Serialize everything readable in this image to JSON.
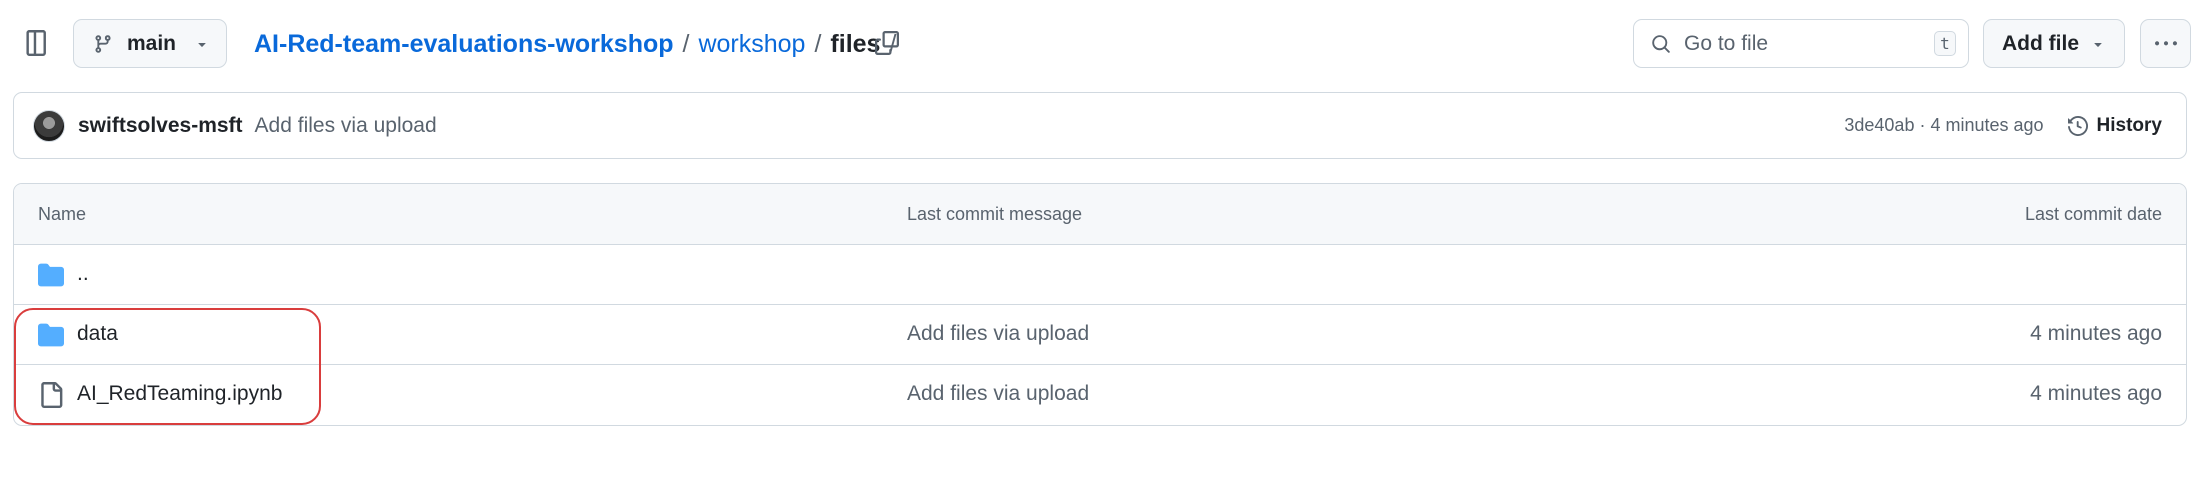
{
  "topbar": {
    "branch": "main",
    "breadcrumb": {
      "repo": "AI-Red-team-evaluations-workshop",
      "sep1": "/",
      "dir": "workshop",
      "sep2": "/",
      "current": "files",
      "sep3": "/"
    },
    "search_placeholder": "Go to file",
    "search_shortcut": "t",
    "add_file_label": "Add file"
  },
  "commit": {
    "author": "swiftsolves-msft",
    "message": "Add files via upload",
    "hash_time": "3de40ab · 4 minutes ago",
    "history_label": "History"
  },
  "table": {
    "headers": {
      "name": "Name",
      "message": "Last commit message",
      "date": "Last commit date"
    },
    "rows": [
      {
        "icon": "folder-icon",
        "name": "..",
        "message": "",
        "date": ""
      },
      {
        "icon": "folder-icon",
        "name": "data",
        "message": "Add files via upload",
        "date": "4 minutes ago"
      },
      {
        "icon": "file-icon",
        "name": "AI_RedTeaming.ipynb",
        "message": "Add files via upload",
        "date": "4 minutes ago"
      }
    ]
  },
  "colors": {
    "link": "#0969da",
    "folder": "#54aeff",
    "highlight": "#d93d3d",
    "muted": "#59636e"
  }
}
